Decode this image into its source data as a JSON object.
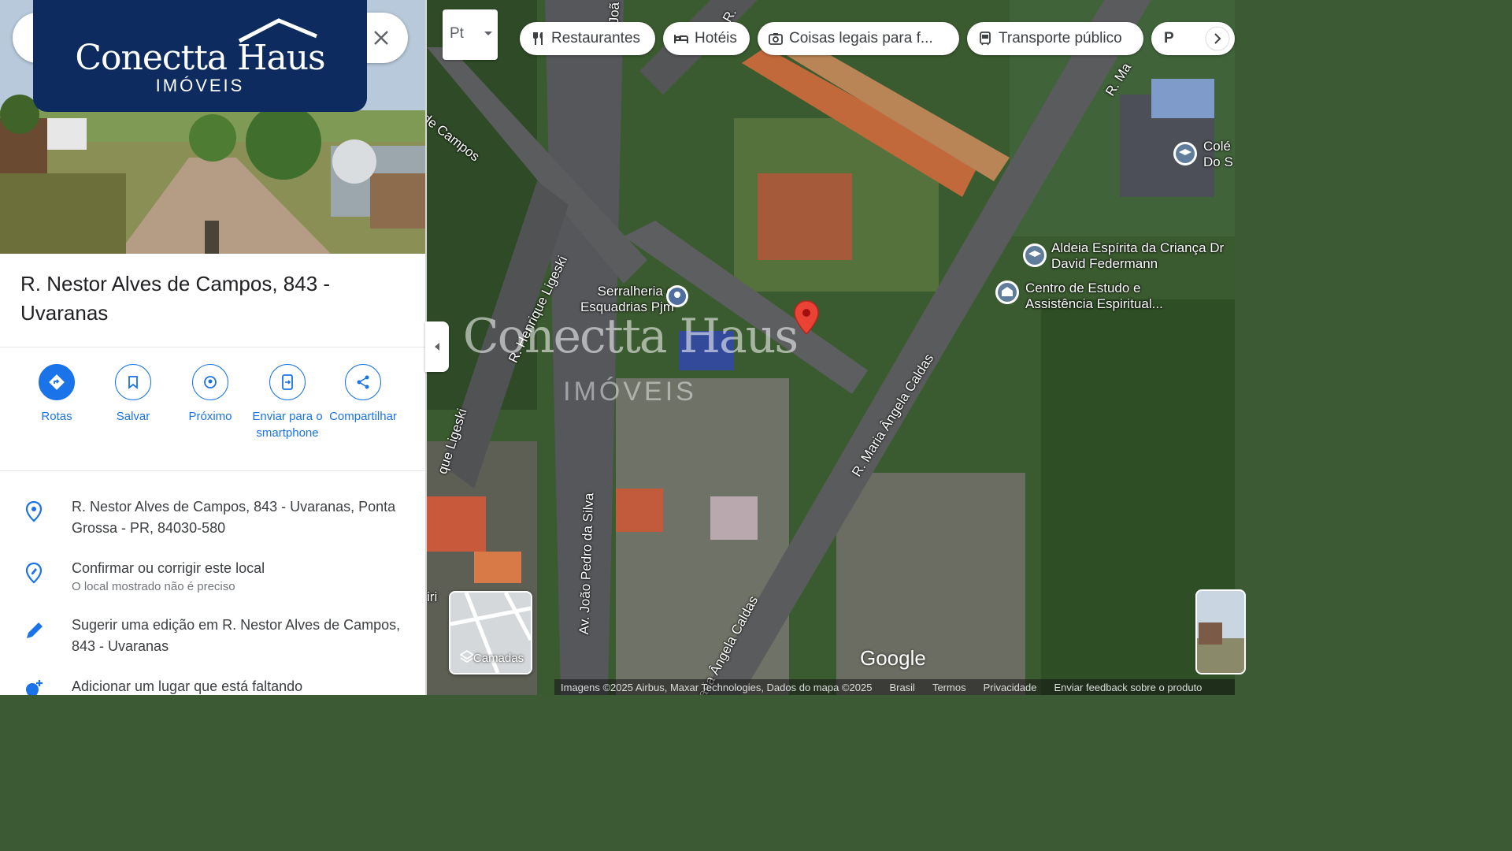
{
  "logo": {
    "name": "Conectta Haus",
    "sub": "IMÓVEIS"
  },
  "panel": {
    "title": "R. Nestor Alves de Campos, 843 - Uvaranas",
    "actions": [
      {
        "label": "Rotas",
        "icon": "directions-icon"
      },
      {
        "label": "Salvar",
        "icon": "bookmark-icon"
      },
      {
        "label": "Próximo",
        "icon": "nearby-icon"
      },
      {
        "label": "Enviar para o smartphone",
        "icon": "send-to-phone-icon"
      },
      {
        "label": "Compartilhar",
        "icon": "share-icon"
      }
    ],
    "info": [
      {
        "text": "R. Nestor Alves de Campos, 843 - Uvaranas, Ponta Grossa - PR, 84030-580",
        "sub": "",
        "icon": "location-pin-icon"
      },
      {
        "text": "Confirmar ou corrigir este local",
        "sub": "O local mostrado não é preciso",
        "icon": "location-edit-icon"
      },
      {
        "text": "Sugerir uma edição em R. Nestor Alves de Campos, 843 - Uvaranas",
        "sub": "",
        "icon": "pencil-icon"
      },
      {
        "text": "Adicionar um lugar que está faltando",
        "sub": "",
        "icon": "add-place-icon"
      }
    ]
  },
  "map": {
    "chips": [
      {
        "label": "Restaurantes",
        "icon": "restaurant-icon"
      },
      {
        "label": "Hotéis",
        "icon": "hotel-icon"
      },
      {
        "label": "Coisas legais para f...",
        "icon": "camera-icon"
      },
      {
        "label": "Transporte público",
        "icon": "transit-icon"
      },
      {
        "label": "P",
        "icon": "parking-icon"
      }
    ],
    "pt_label": "Pt",
    "streets": {
      "campos": "de Campos",
      "ligeski_top": "R. Henrique Ligeski",
      "ligeski_left": "que Ligeski",
      "joao_pedro": "Av. João Pedro da Silva",
      "maria_top": "R. Maria Ângela Caldas",
      "maria_bottom": "aria Ângela Caldas",
      "r_top": "R. ",
      "r_ma": "R. Ma",
      "joa": "Joã",
      "iri": "iri"
    },
    "pois": {
      "serralheria": "Serralheria e Esquadrias Pjm",
      "aldeia": "Aldeia Espírita da Criança Dr David Federmann",
      "centro": "Centro de Estudo e Assistência Espiritual...",
      "colegio": "Colé Do S"
    },
    "layers_label": "Camadas",
    "google": "Google",
    "footer": [
      "Imagens ©2025 Airbus, Maxar Technologies, Dados do mapa ©2025",
      "Brasil",
      "Termos",
      "Privacidade",
      "Enviar feedback sobre o produto"
    ],
    "watermark": {
      "name": "Conectta Haus",
      "sub": "IMÓVEIS"
    }
  }
}
